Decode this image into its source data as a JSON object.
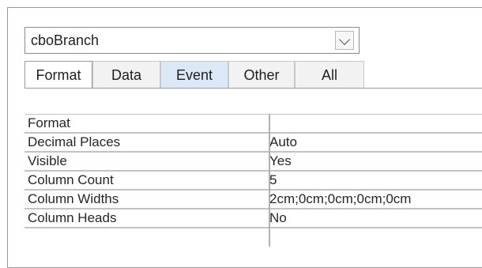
{
  "selector": {
    "value": "cboBranch"
  },
  "tabs": [
    "Format",
    "Data",
    "Event",
    "Other",
    "All"
  ],
  "properties": [
    {
      "label": "Format",
      "value": ""
    },
    {
      "label": "Decimal Places",
      "value": "Auto"
    },
    {
      "label": "Visible",
      "value": "Yes"
    },
    {
      "label": "Column Count",
      "value": "5"
    },
    {
      "label": "Column Widths",
      "value": "2cm;0cm;0cm;0cm;0cm"
    },
    {
      "label": "Column Heads",
      "value": "No"
    }
  ]
}
